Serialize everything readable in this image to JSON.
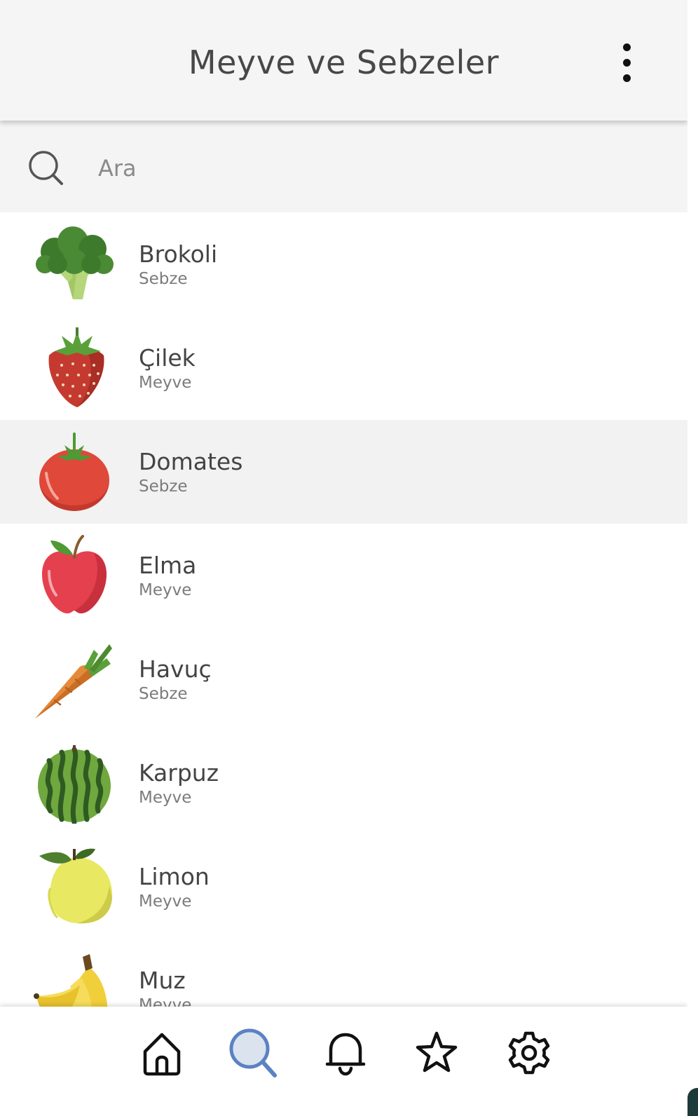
{
  "header": {
    "title": "Meyve ve Sebzeler"
  },
  "search": {
    "placeholder": "Ara",
    "value": ""
  },
  "items": [
    {
      "name": "Brokoli",
      "type": "Sebze",
      "icon": "broccoli-icon"
    },
    {
      "name": "Çilek",
      "type": "Meyve",
      "icon": "strawberry-icon"
    },
    {
      "name": "Domates",
      "type": "Sebze",
      "icon": "tomato-icon",
      "selected": true
    },
    {
      "name": "Elma",
      "type": "Meyve",
      "icon": "apple-icon"
    },
    {
      "name": "Havuç",
      "type": "Sebze",
      "icon": "carrot-icon"
    },
    {
      "name": "Karpuz",
      "type": "Meyve",
      "icon": "watermelon-icon"
    },
    {
      "name": "Limon",
      "type": "Meyve",
      "icon": "lemon-icon"
    },
    {
      "name": "Muz",
      "type": "Meyve",
      "icon": "banana-icon"
    }
  ],
  "bottom_nav": [
    {
      "icon": "home-icon"
    },
    {
      "icon": "search-icon",
      "active": true
    },
    {
      "icon": "bell-icon"
    },
    {
      "icon": "star-icon"
    },
    {
      "icon": "gear-icon"
    }
  ],
  "colors": {
    "active_nav": "#5b82c2",
    "selected_row": "#f2f2f2",
    "header_bg": "#f5f5f5"
  }
}
